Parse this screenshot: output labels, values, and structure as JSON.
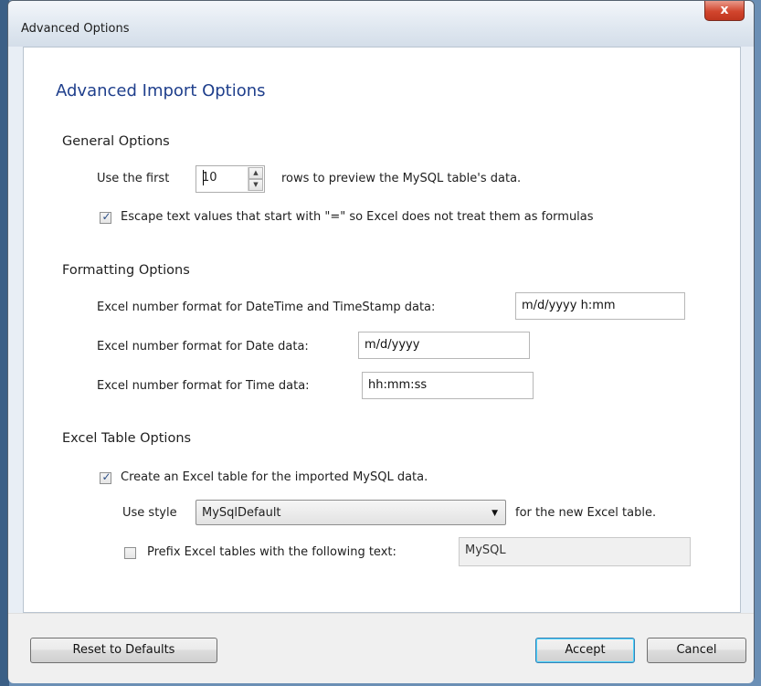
{
  "window": {
    "title": "Advanced Options",
    "close_glyph": "x"
  },
  "heading": "Advanced Import Options",
  "general": {
    "title": "General Options",
    "preview_prefix": "Use the first",
    "preview_value": "10",
    "preview_suffix": "rows to preview the MySQL table's data.",
    "escape_checked": true,
    "escape_label": "Escape text values that start with \"=\" so Excel does not treat them as formulas"
  },
  "formatting": {
    "title": "Formatting Options",
    "datetime_label": "Excel number format for DateTime and TimeStamp data:",
    "datetime_value": "m/d/yyyy h:mm",
    "date_label": "Excel number format for Date data:",
    "date_value": "m/d/yyyy",
    "time_label": "Excel number format for Time data:",
    "time_value": "hh:mm:ss"
  },
  "table": {
    "title": "Excel Table Options",
    "create_checked": true,
    "create_label": "Create an Excel table for the imported MySQL data.",
    "style_prefix": "Use style",
    "style_value": "MySqlDefault",
    "style_suffix": "for the new Excel table.",
    "prefix_checked": false,
    "prefix_label": "Prefix Excel tables with the following text:",
    "prefix_value": "MySQL"
  },
  "buttons": {
    "reset": "Reset to Defaults",
    "accept": "Accept",
    "cancel": "Cancel"
  },
  "icons": {
    "checkmark": "✓",
    "spin_up": "▲",
    "spin_down": "▼",
    "dropdown": "▼"
  }
}
